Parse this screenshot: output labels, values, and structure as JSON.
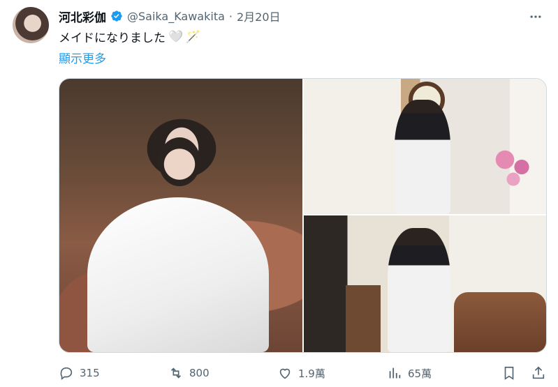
{
  "author": {
    "name": "河北彩伽",
    "handle": "@Saika_Kawakita",
    "separator": "·",
    "date": "2月20日"
  },
  "tweet": {
    "text": "メイドになりました",
    "emoji_heart": "🤍",
    "emoji_wand": "🪄",
    "show_more": "顯示更多"
  },
  "stats": {
    "replies": "315",
    "retweets": "800",
    "likes": "1.9萬",
    "views": "65萬"
  },
  "colors": {
    "accent": "#1d9bf0",
    "muted": "#536471",
    "text": "#0f1419"
  }
}
